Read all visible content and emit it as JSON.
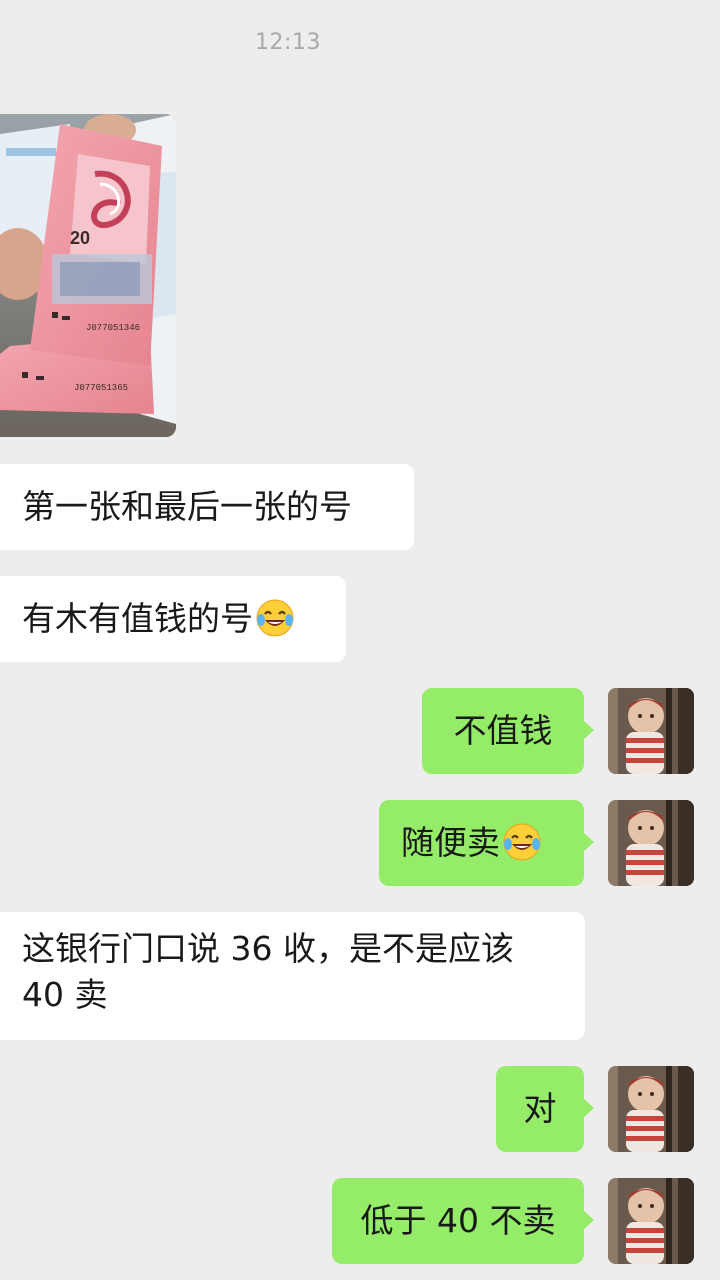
{
  "status": {
    "time": "12:13"
  },
  "messages": {
    "m1": {
      "text": "第一张和最后一张的号"
    },
    "m2": {
      "text": "有木有值钱的号",
      "emoji": "laugh-cry-emoji"
    },
    "m3": {
      "text": "不值钱"
    },
    "m4": {
      "text": "随便卖",
      "emoji": "laugh-cry-emoji"
    },
    "m5": {
      "line1": "这银行门口说 36 收，是不是应该",
      "line2": "40 卖"
    },
    "m6": {
      "text": "对"
    },
    "m7": {
      "text": "低于 40 不卖"
    }
  },
  "photo": {
    "banknote_values": [
      "20"
    ],
    "serials": [
      "J077051346",
      "J077051365"
    ]
  },
  "colors": {
    "outgoing_bubble": "#95ec69",
    "incoming_bubble": "#ffffff",
    "background": "#ededed"
  }
}
